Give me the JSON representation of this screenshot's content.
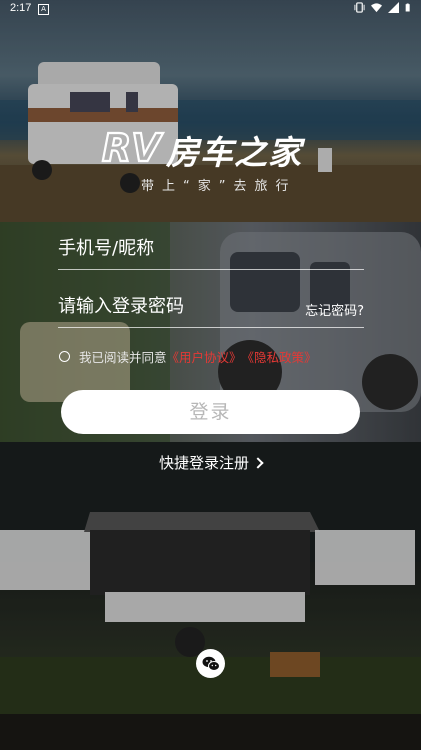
{
  "status_bar": {
    "time": "2:17",
    "notification_icon": "A"
  },
  "brand": {
    "logo_mark": "RV",
    "name": "房车之家",
    "slogan": "带上“家”去旅行"
  },
  "form": {
    "phone_placeholder": "手机号/昵称",
    "password_placeholder": "请输入登录密码",
    "forgot_label": "忘记密码?"
  },
  "agreement": {
    "prefix": "我已阅读并同意",
    "user_agreement": "《用户协议》",
    "privacy_policy": "《隐私政策》"
  },
  "login_button": "登录",
  "quick_register": "快捷登录注册",
  "third_party": {
    "wechat_icon": "wechat-icon"
  },
  "colors": {
    "link_red": "#e53935",
    "button_bg": "#ffffff",
    "button_text": "#b7b7b7"
  }
}
